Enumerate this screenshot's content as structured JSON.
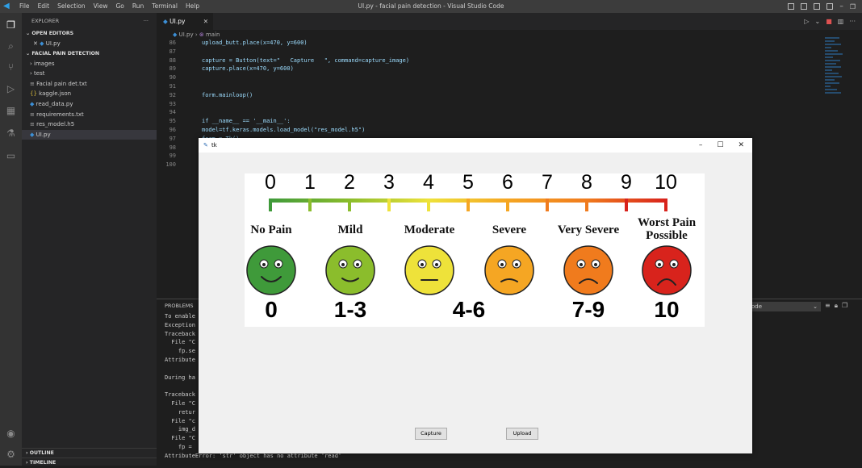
{
  "app": {
    "window_title": "UI.py - facial pain detection - Visual Studio Code",
    "menu": [
      "File",
      "Edit",
      "Selection",
      "View",
      "Go",
      "Run",
      "Terminal",
      "Help"
    ]
  },
  "sidebar": {
    "title": "EXPLORER",
    "open_editors_label": "OPEN EDITORS",
    "open_editor_file": "UI.py",
    "folder_label": "FACIAL PAIN DETECTION",
    "items": [
      {
        "label": "images",
        "kind": "folder"
      },
      {
        "label": "test",
        "kind": "folder"
      },
      {
        "label": "Facial pain det.txt",
        "kind": "text"
      },
      {
        "label": "kaggle.json",
        "kind": "json"
      },
      {
        "label": "read_data.py",
        "kind": "python"
      },
      {
        "label": "requirements.txt",
        "kind": "text"
      },
      {
        "label": "res_model.h5",
        "kind": "text"
      },
      {
        "label": "UI.py",
        "kind": "python"
      }
    ],
    "outline_label": "OUTLINE",
    "timeline_label": "TIMELINE"
  },
  "editor": {
    "tab_label": "UI.py",
    "breadcrumb": [
      "UI.py",
      "main"
    ],
    "lines": [
      {
        "n": "86",
        "code": "upload_butt.place(x=470, y=600)"
      },
      {
        "n": "87",
        "code": ""
      },
      {
        "n": "88",
        "code": "capture = Button(text=\"   Capture   \", command=capture_image)"
      },
      {
        "n": "89",
        "code": "capture.place(x=470, y=600)"
      },
      {
        "n": "90",
        "code": ""
      },
      {
        "n": "91",
        "code": ""
      },
      {
        "n": "92",
        "code": "form.mainloop()"
      },
      {
        "n": "93",
        "code": ""
      },
      {
        "n": "94",
        "code": ""
      },
      {
        "n": "95",
        "code": "if __name__ == '__main__':"
      },
      {
        "n": "96",
        "code": "model=tf.keras.models.load_model(\"res_model.h5\")"
      },
      {
        "n": "97",
        "code": "form = Tk()"
      },
      {
        "n": "98",
        "code": ""
      },
      {
        "n": "99",
        "code": ""
      },
      {
        "n": "100",
        "code": ""
      }
    ]
  },
  "panel": {
    "tab_label": "PROBLEMS",
    "select_value": "ode",
    "terminal_lines": [
      "To enable",
      "Exception",
      "Traceback",
      "  File \"C",
      "    fp.se",
      "Attribute",
      "",
      "During ha",
      "",
      "Traceback",
      "  File \"C",
      "    retur",
      "  File \"c",
      "    img_d",
      "  File \"C",
      "    fp =",
      "AttributeError: 'str' object has no attribute 'read'"
    ]
  },
  "tk_window": {
    "title": "tk",
    "buttons": {
      "capture": "Capture",
      "upload": "Upload"
    },
    "pain_scale": {
      "numbers": [
        "0",
        "1",
        "2",
        "3",
        "4",
        "5",
        "6",
        "7",
        "8",
        "9",
        "10"
      ],
      "levels": [
        {
          "label": "No Pain",
          "range": "0",
          "color": "#3f9a3a"
        },
        {
          "label": "Mild",
          "range": "1-3",
          "color": "#8bbd2c"
        },
        {
          "label": "Moderate",
          "range": "4-6",
          "color": "#eee23a"
        },
        {
          "label": "Severe",
          "range": "",
          "color": "#f5a623"
        },
        {
          "label": "Very Severe",
          "range": "7-9",
          "color": "#f07b1d"
        },
        {
          "label": "Worst Pain Possible",
          "range": "10",
          "color": "#d8231c"
        }
      ]
    }
  }
}
